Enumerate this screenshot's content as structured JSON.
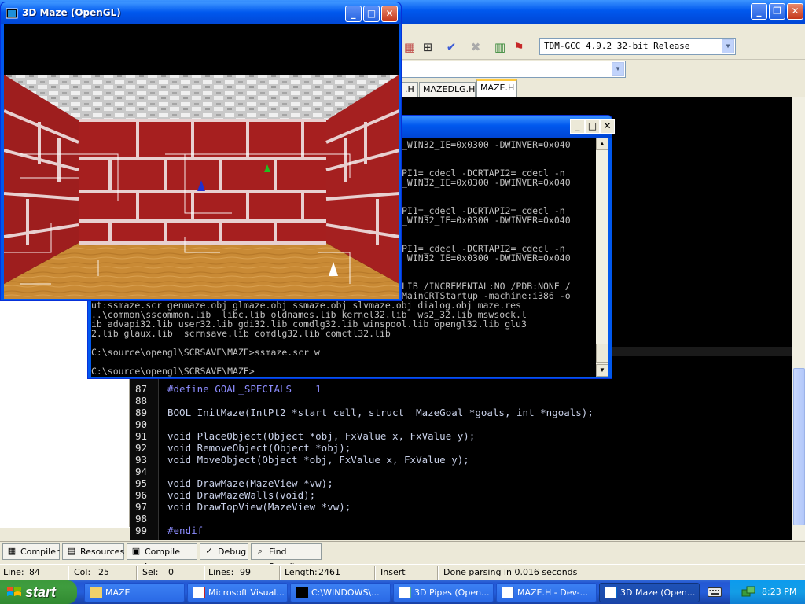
{
  "devcpp": {
    "toolbar": {
      "compiler": "TDM-GCC 4.9.2 32-bit Release",
      "icons": [
        "grid-icon",
        "grid4-icon",
        "check-icon",
        "cross-icon",
        "chart-icon",
        "profile-icon"
      ]
    },
    "tabs": [
      ".H",
      "MAZEDLG.H",
      "MAZE.H"
    ],
    "editor": {
      "lines": [
        {
          "num": "87",
          "text": "#define GOAL_SPECIALS    1"
        },
        {
          "num": "88",
          "text": ""
        },
        {
          "num": "89",
          "text": "BOOL InitMaze(IntPt2 *start_cell, struct _MazeGoal *goals, int *ngoals);"
        },
        {
          "num": "90",
          "text": ""
        },
        {
          "num": "91",
          "text": "void PlaceObject(Object *obj, FxValue x, FxValue y);"
        },
        {
          "num": "92",
          "text": "void RemoveObject(Object *obj);"
        },
        {
          "num": "93",
          "text": "void MoveObject(Object *obj, FxValue x, FxValue y);"
        },
        {
          "num": "94",
          "text": ""
        },
        {
          "num": "95",
          "text": "void DrawMaze(MazeView *vw);"
        },
        {
          "num": "96",
          "text": "void DrawMazeWalls(void);"
        },
        {
          "num": "97",
          "text": "void DrawTopView(MazeView *vw);"
        },
        {
          "num": "98",
          "text": ""
        },
        {
          "num": "99",
          "text": "#endif"
        }
      ]
    },
    "bottom_tabs": [
      {
        "label": "Compiler",
        "icon": "compiler-icon"
      },
      {
        "label": "Resources",
        "icon": "resources-icon"
      },
      {
        "label": "Compile Log",
        "icon": "compile-log-icon"
      },
      {
        "label": "Debug",
        "icon": "debug-icon"
      },
      {
        "label": "Find Results",
        "icon": "find-results-icon"
      }
    ],
    "status": {
      "line_label": "Line:",
      "line": "84",
      "col_label": "Col:",
      "col": "25",
      "sel_label": "Sel:",
      "sel": "0",
      "lines_label": "Lines:",
      "lines": "99",
      "length_label": "Length:",
      "length": "2461",
      "mode": "Insert",
      "message": "Done parsing in 0.016 seconds"
    }
  },
  "console": {
    "lines": [
      "_WIN32_IE=0x0300 -DWINVER=0x040",
      "",
      "",
      "PI1=_cdecl -DCRTAPI2=_cdecl -n",
      "_WIN32_IE=0x0300 -DWINVER=0x040",
      "",
      "",
      "PI1=_cdecl -DCRTAPI2=_cdecl -n",
      "_WIN32_IE=0x0300 -DWINVER=0x040",
      "",
      "",
      "PI1=_cdecl -DCRTAPI2=_cdecl -n",
      "_WIN32_IE=0x0300 -DWINVER=0x040",
      "",
      "",
      "LIB /INCREMENTAL:NO /PDB:NONE /",
      "MainCRTStartup -machine:i386 -o",
      "ut:ssmaze.scr genmaze.obj glmaze.obj ssmaze.obj slvmaze.obj dialog.obj maze.res",
      "..\\common\\sscommon.lib  libc.lib oldnames.lib kernel32.lib  ws2_32.lib mswsock.l",
      "ib advapi32.lib user32.lib gdi32.lib comdlg32.lib winspool.lib opengl32.lib glu3",
      "2.lib glaux.lib  scrnsave.lib comdlg32.lib comctl32.lib",
      "",
      "C:\\source\\opengl\\SCRSAVE\\MAZE>ssmaze.scr w",
      "",
      "C:\\source\\opengl\\SCRSAVE\\MAZE>"
    ]
  },
  "maze_window": {
    "title": "3D Maze (OpenGL)"
  },
  "taskbar": {
    "start": "start",
    "tasks": [
      {
        "label": "MAZE",
        "icon": "folder-icon"
      },
      {
        "label": "Microsoft Visual...",
        "icon": "visual-studio-icon"
      },
      {
        "label": "C:\\WINDOWS\\...",
        "icon": "console-icon"
      },
      {
        "label": "3D Pipes (Open...",
        "icon": "pipes-icon"
      },
      {
        "label": "MAZE.H - Dev-...",
        "icon": "devcpp-icon"
      },
      {
        "label": "3D Maze (Open...",
        "icon": "maze-icon"
      }
    ],
    "clock": "8:23 PM"
  }
}
